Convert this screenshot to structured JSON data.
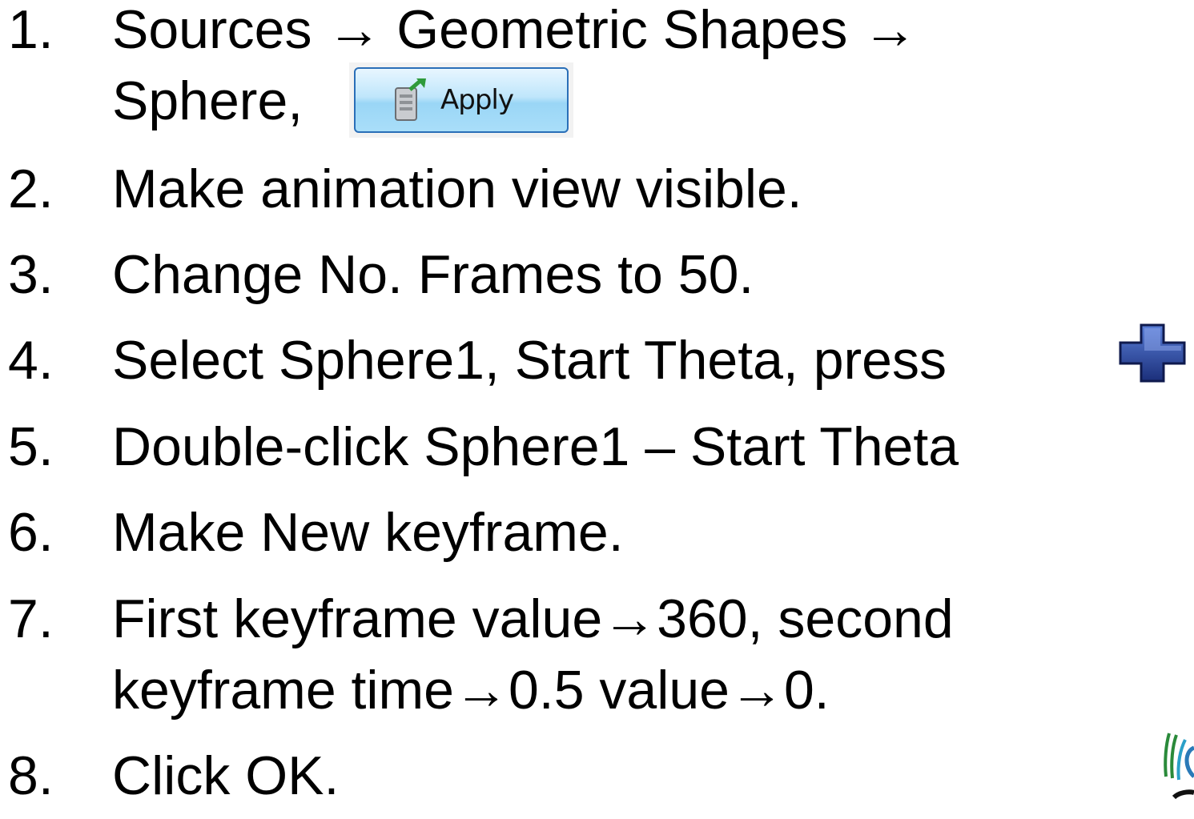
{
  "steps": [
    {
      "num": "1.",
      "line1": "Sources → Geometric Shapes →",
      "line2": "Sphere,"
    },
    {
      "num": "2.",
      "text": "Make animation view visible."
    },
    {
      "num": "3.",
      "text": "Change No. Frames to 50."
    },
    {
      "num": "4.",
      "text": "Select Sphere1, Start Theta, press"
    },
    {
      "num": "5.",
      "text": "Double-click Sphere1 – Start Theta"
    },
    {
      "num": "6.",
      "text": "Make New keyframe."
    },
    {
      "num": "7.",
      "line1": "First keyframe value→360, second",
      "line2": "keyframe time→0.5 value→0."
    },
    {
      "num": "8.",
      "text": "Click OK."
    }
  ],
  "apply_button": {
    "label": "Apply",
    "icon": "apply-icon"
  },
  "plus_button": {
    "icon": "plus-icon",
    "color": "#1f3f9a"
  },
  "logo": {
    "icon": "logo-icon",
    "color": "#2a8a3a"
  }
}
